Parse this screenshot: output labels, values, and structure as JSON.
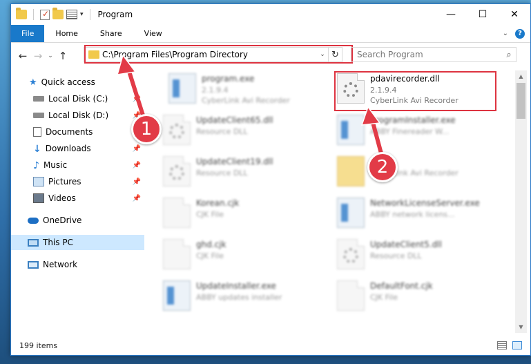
{
  "window": {
    "title": "Program",
    "controls": {
      "minimize": "—",
      "maximize": "☐",
      "close": "✕"
    }
  },
  "ribbon": {
    "tabs": [
      "File",
      "Home",
      "Share",
      "View"
    ]
  },
  "nav": {
    "address": "C:\\Program Files\\Program Directory",
    "search_placeholder": "Search Program"
  },
  "sidebar": {
    "items": [
      {
        "label": "Quick access",
        "icon": "star-icon",
        "pinned": false
      },
      {
        "label": "Local Disk (C:)",
        "icon": "drive-icon",
        "pinned": true
      },
      {
        "label": "Local Disk (D:)",
        "icon": "drive-icon",
        "pinned": true
      },
      {
        "label": "Documents",
        "icon": "documents-icon",
        "pinned": true
      },
      {
        "label": "Downloads",
        "icon": "download-icon",
        "pinned": true
      },
      {
        "label": "Music",
        "icon": "music-icon",
        "pinned": true
      },
      {
        "label": "Pictures",
        "icon": "pictures-icon",
        "pinned": true
      },
      {
        "label": "Videos",
        "icon": "videos-icon",
        "pinned": true
      },
      {
        "label": "OneDrive",
        "icon": "cloud-icon",
        "pinned": false
      },
      {
        "label": "This PC",
        "icon": "computer-icon",
        "pinned": false
      },
      {
        "label": "Network",
        "icon": "network-icon",
        "pinned": false
      }
    ]
  },
  "files": [
    {
      "name": "program.exe",
      "sub1": "2.1.9.4",
      "sub2": "CyberLink Avi Recorder",
      "type": "app",
      "blurred": true
    },
    {
      "name": "pdavirecorder.dll",
      "sub1": "2.1.9.4",
      "sub2": "CyberLink Avi Recorder",
      "type": "dll",
      "blurred": false
    },
    {
      "name": "UpdateClient65.dll",
      "sub1": "Resource DLL",
      "sub2": "",
      "type": "dll",
      "blurred": true
    },
    {
      "name": "programInstaller.exe",
      "sub1": "ABBY Finereader W...",
      "sub2": "",
      "type": "app",
      "blurred": true
    },
    {
      "name": "UpdateClient19.dll",
      "sub1": "Resource DLL",
      "sub2": "",
      "type": "dll",
      "blurred": true
    },
    {
      "name": "",
      "sub1": "CyberLink Avi Recorder",
      "sub2": "",
      "type": "folder",
      "blurred": true
    },
    {
      "name": "Korean.cjk",
      "sub1": "CJK File",
      "sub2": "",
      "type": "doc",
      "blurred": true
    },
    {
      "name": "NetworkLicenseServer.exe",
      "sub1": "ABBY network licens...",
      "sub2": "",
      "type": "app",
      "blurred": true
    },
    {
      "name": "ghd.cjk",
      "sub1": "CJK File",
      "sub2": "",
      "type": "doc",
      "blurred": true
    },
    {
      "name": "UpdateClient5.dll",
      "sub1": "Resource DLL",
      "sub2": "",
      "type": "dll",
      "blurred": true
    },
    {
      "name": "UpdateInstaller.exe",
      "sub1": "ABBY updates installer",
      "sub2": "",
      "type": "app",
      "blurred": true
    },
    {
      "name": "DefaultFont.cjk",
      "sub1": "CJK File",
      "sub2": "",
      "type": "doc",
      "blurred": true
    }
  ],
  "status": {
    "count": "199 items"
  },
  "annotations": {
    "badge1": "1",
    "badge2": "2",
    "color": "#e23b47"
  }
}
